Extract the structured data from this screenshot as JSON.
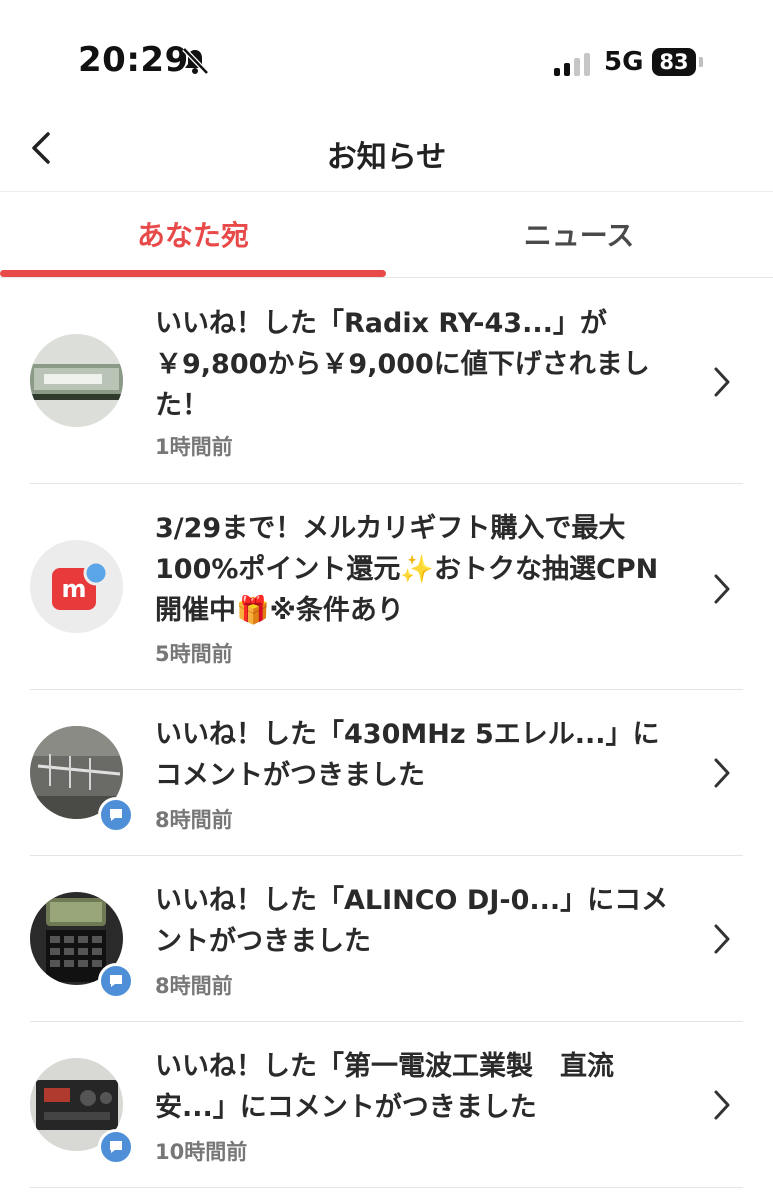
{
  "status_bar": {
    "time": "20:29",
    "network": "5G",
    "battery": "83"
  },
  "header": {
    "title": "お知らせ"
  },
  "tabs": [
    {
      "label": "あなた宛",
      "active": true
    },
    {
      "label": "ニュース",
      "active": false
    }
  ],
  "notifications": [
    {
      "text": "いいね！した「Radix RY-43...」が￥9,800から￥9,000に値下げされました！",
      "time": "1時間前",
      "avatar": "product-photo-antenna-box"
    },
    {
      "text": "3/29まで！メルカリギフト購入で最大100%ポイント還元✨おトクな抽選CPN開催中🎁※条件あり",
      "time": "5時間前",
      "avatar": "mercari-logo"
    },
    {
      "text": "いいね！した「430MHz 5エレル...」にコメントがつきました",
      "time": "8時間前",
      "avatar": "product-photo-yagi-antenna",
      "badge": "comment-icon"
    },
    {
      "text": "いいね！した「ALINCO DJ-0...」にコメントがつきました",
      "time": "8時間前",
      "avatar": "product-photo-handheld-radio",
      "badge": "comment-icon"
    },
    {
      "text": "いいね！した「第一電波工業製　直流安...」にコメントがつきました",
      "time": "10時間前",
      "avatar": "product-photo-power-supply",
      "badge": "comment-icon"
    }
  ],
  "colors": {
    "accent": "#e84a4a",
    "badge": "#4f8fd8",
    "text": "#2a2a2a",
    "subtext": "#777777"
  }
}
